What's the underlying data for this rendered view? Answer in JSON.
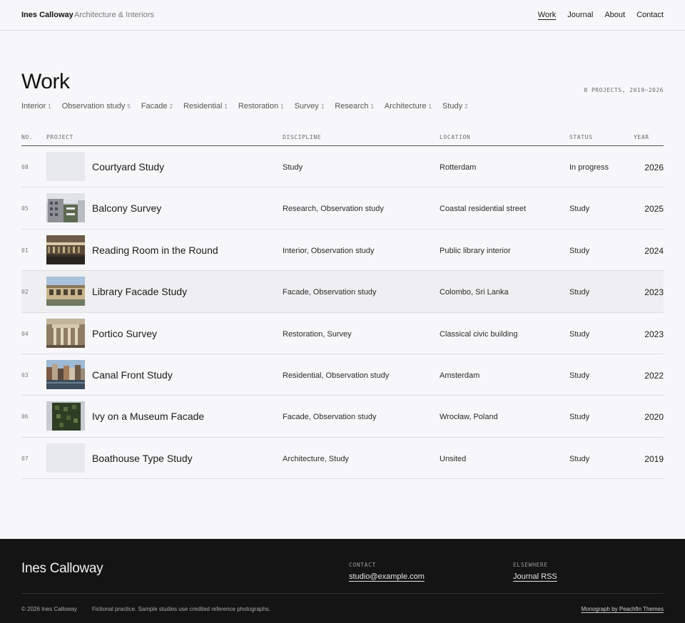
{
  "header": {
    "brand": "Ines Calloway",
    "tagline": "Architecture & Interiors",
    "nav": [
      "Work",
      "Journal",
      "About",
      "Contact"
    ],
    "active_nav": "Work"
  },
  "page": {
    "title": "Work",
    "summary": "8 PROJECTS, 2019–2026"
  },
  "filters": [
    {
      "label": "Interior",
      "count": "1"
    },
    {
      "label": "Observation study",
      "count": "5"
    },
    {
      "label": "Facade",
      "count": "2"
    },
    {
      "label": "Residential",
      "count": "1"
    },
    {
      "label": "Restoration",
      "count": "1"
    },
    {
      "label": "Survey",
      "count": "1"
    },
    {
      "label": "Research",
      "count": "1"
    },
    {
      "label": "Architecture",
      "count": "1"
    },
    {
      "label": "Study",
      "count": "2"
    }
  ],
  "table": {
    "headers": {
      "no": "NO.",
      "project": "PROJECT",
      "discipline": "DISCIPLINE",
      "location": "LOCATION",
      "status": "STATUS",
      "year": "YEAR"
    },
    "rows": [
      {
        "no": "08",
        "project": "Courtyard Study",
        "discipline": "Study",
        "location": "Rotterdam",
        "status": "In progress",
        "year": "2026",
        "thumb": "empty"
      },
      {
        "no": "05",
        "project": "Balcony Survey",
        "discipline": "Research, Observation study",
        "location": "Coastal residential street",
        "status": "Study",
        "year": "2025",
        "thumb": "balcony"
      },
      {
        "no": "01",
        "project": "Reading Room in the Round",
        "discipline": "Interior, Observation study",
        "location": "Public library interior",
        "status": "Study",
        "year": "2024",
        "thumb": "reading"
      },
      {
        "no": "02",
        "project": "Library Facade Study",
        "discipline": "Facade, Observation study",
        "location": "Colombo, Sri Lanka",
        "status": "Study",
        "year": "2023",
        "thumb": "library",
        "highlighted": true
      },
      {
        "no": "04",
        "project": "Portico Survey",
        "discipline": "Restoration, Survey",
        "location": "Classical civic building",
        "status": "Study",
        "year": "2023",
        "thumb": "portico"
      },
      {
        "no": "03",
        "project": "Canal Front Study",
        "discipline": "Residential, Observation study",
        "location": "Amsterdam",
        "status": "Study",
        "year": "2022",
        "thumb": "canal"
      },
      {
        "no": "06",
        "project": "Ivy on a Museum Facade",
        "discipline": "Facade, Observation study",
        "location": "Wrocław, Poland",
        "status": "Study",
        "year": "2020",
        "thumb": "ivy"
      },
      {
        "no": "07",
        "project": "Boathouse Type Study",
        "discipline": "Architecture, Study",
        "location": "Unsited",
        "status": "Study",
        "year": "2019",
        "thumb": "empty"
      }
    ]
  },
  "footer": {
    "name": "Ines Calloway",
    "contact_label": "CONTACT",
    "contact_email": "studio@example.com",
    "elsewhere_label": "ELSEWHERE",
    "elsewhere_link": "Journal RSS",
    "copyright": "© 2026 Ines Calloway",
    "note": "Fictional practice. Sample studies use credited reference photographs.",
    "credit": "Monograph by Peachfin Themes"
  },
  "colors": {
    "background": "#f7f7f9",
    "footer_bg": "#141414",
    "row_highlight": "#efeff1",
    "thumb_placeholder": "#e8e9ec"
  }
}
